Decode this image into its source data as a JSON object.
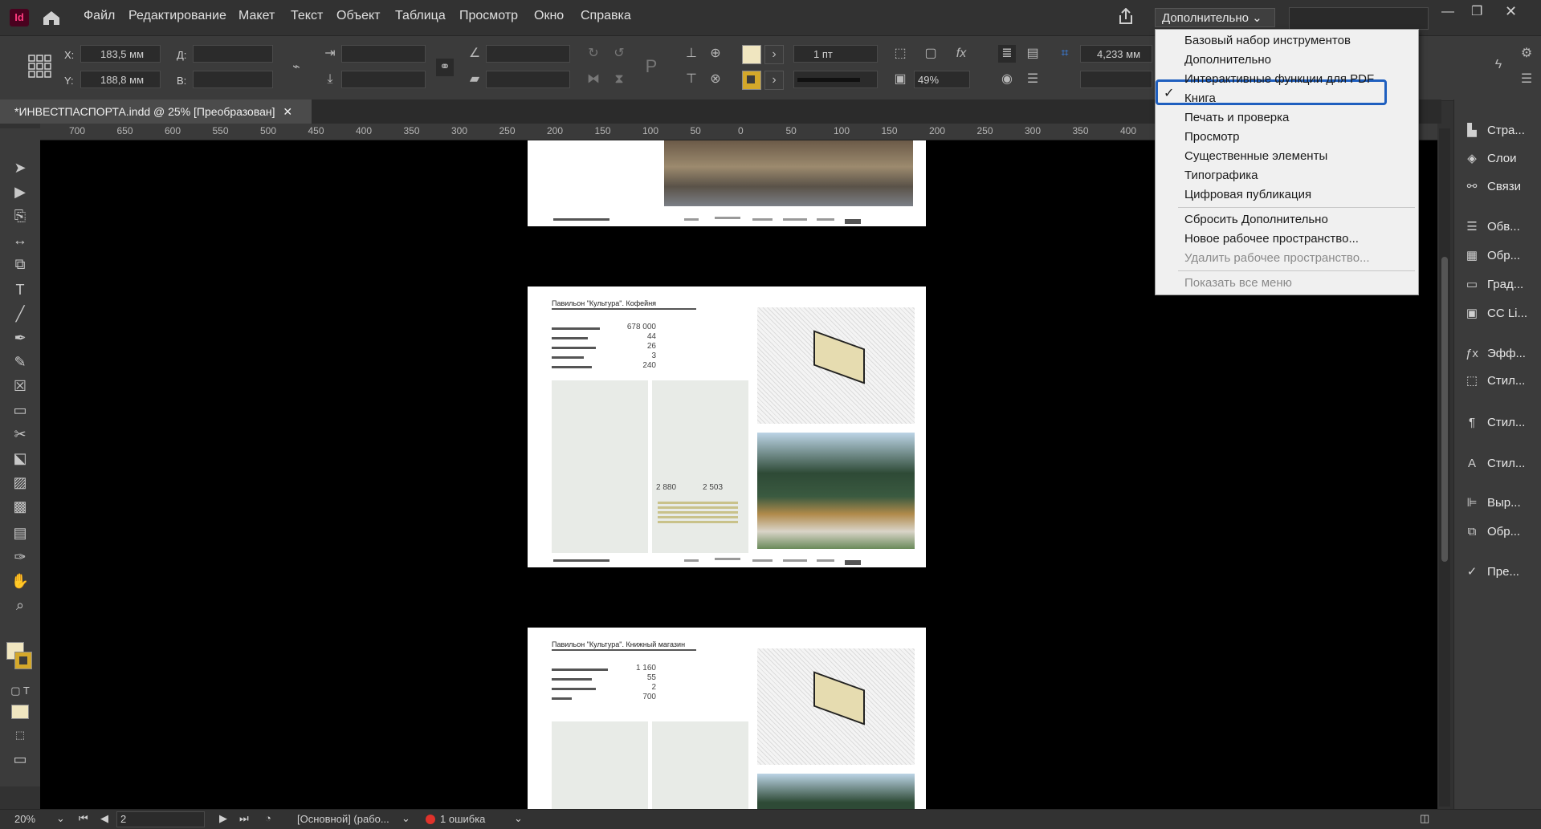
{
  "app": {
    "logo_text": "Id",
    "menu": [
      "Файл",
      "Редактирование",
      "Макет",
      "Текст",
      "Объект",
      "Таблица",
      "Просмотр",
      "Окно",
      "Справка"
    ],
    "workspace_label": "Дополнительно ⌄"
  },
  "control": {
    "x_label": "X:",
    "x_value": "183,5 мм",
    "y_label": "Y:",
    "y_value": "188,8 мм",
    "w_label": "Д:",
    "h_label": "В:",
    "stroke_weight": "1 пт",
    "opacity": "49%",
    "gutter": "4,233 мм"
  },
  "tab": {
    "title": "*ИНВЕСТПАСПОРТА.indd @ 25% [Преобразован]",
    "close": "✕"
  },
  "ruler_ticks": [
    "700",
    "650",
    "600",
    "550",
    "500",
    "450",
    "400",
    "350",
    "300",
    "250",
    "200",
    "150",
    "100",
    "50",
    "0",
    "50",
    "100",
    "150",
    "200",
    "250",
    "300",
    "350",
    "400"
  ],
  "workspace_menu": {
    "items": [
      "Базовый набор инструментов",
      "Дополнительно",
      "Интерактивные функции для PDF",
      "Книга",
      "Печать и проверка",
      "Просмотр",
      "Существенные элементы",
      "Типографика",
      "Цифровая публикация"
    ],
    "checked": "Дополнительно",
    "actions": [
      "Сбросить Дополнительно",
      "Новое рабочее пространство...",
      "Удалить рабочее пространство..."
    ],
    "show_all": "Показать все меню"
  },
  "pages": {
    "p2": {
      "title": "Павильон \"Культура\". Кофейня",
      "numbers": [
        "678 000",
        "44",
        "26",
        "3",
        "240"
      ],
      "area_a": "2 880",
      "area_b": "2 503"
    },
    "p3": {
      "title": "Павильон \"Культура\". Книжный магазин",
      "numbers": [
        "1 160",
        "55",
        "2",
        "700"
      ]
    }
  },
  "panels": [
    {
      "icon": "pages-icon",
      "label": "Стра..."
    },
    {
      "icon": "layers-icon",
      "label": "Слои"
    },
    {
      "icon": "links-icon",
      "label": "Связи"
    },
    {
      "icon": "stroke-icon",
      "label": "Обв..."
    },
    {
      "icon": "wrap-icon",
      "label": "Обр..."
    },
    {
      "icon": "gradient-icon",
      "label": "Град..."
    },
    {
      "icon": "cc-libraries-icon",
      "label": "CC Li..."
    },
    {
      "icon": "effects-icon",
      "label": "Эфф..."
    },
    {
      "icon": "styles-icon",
      "label": "Стил..."
    },
    {
      "icon": "paragraph-styles-icon",
      "label": "Стил..."
    },
    {
      "icon": "char-styles-icon",
      "label": "Стил..."
    },
    {
      "icon": "align-icon",
      "label": "Выр..."
    },
    {
      "icon": "pathfinder-icon",
      "label": "Обр..."
    },
    {
      "icon": "preflight-icon",
      "label": "Пре..."
    }
  ],
  "status": {
    "zoom": "20%",
    "page": "2",
    "master": "[Основной] (рабо...",
    "errors": "1 ошибка"
  },
  "colors": {
    "accent": "#1f5fbf",
    "error": "#e0322b",
    "fill": "#f0e6c0",
    "stroke": "#d4a82a"
  }
}
